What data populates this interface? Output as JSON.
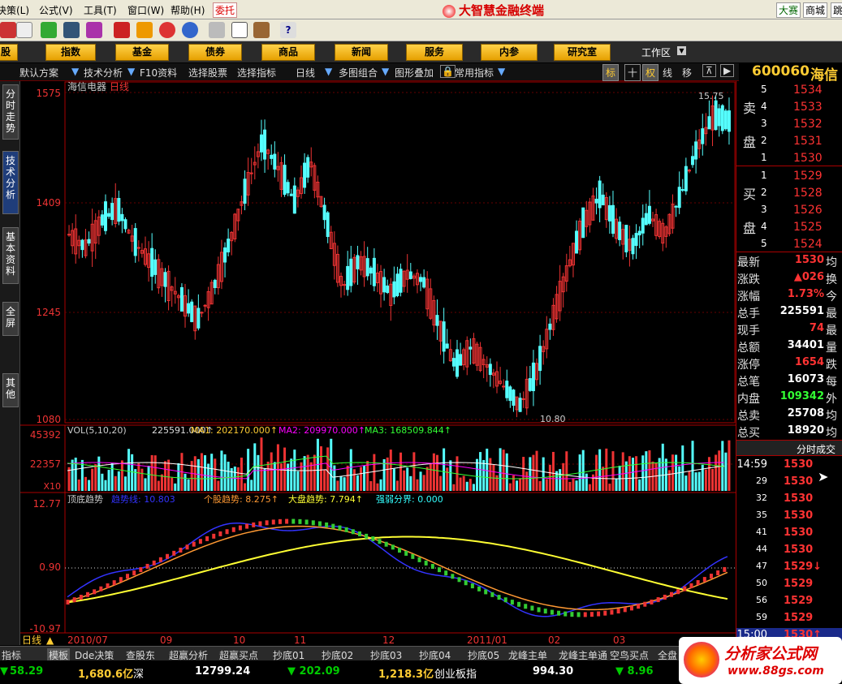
{
  "menu": {
    "items": [
      "决策(L)",
      "公式(V)",
      "工具(T)",
      "窗口(W)",
      "帮助(H)"
    ],
    "entrust": "委托",
    "app_title": "大智慧金融终端",
    "right": [
      "大赛",
      "商城",
      "跳"
    ]
  },
  "toolbar": {
    "icons": [
      "open-icon",
      "order-icon",
      "stocks-icon",
      "chart-icon",
      "alert-icon",
      "news-icon",
      "finance-icon",
      "f10-icon",
      "money-icon",
      "print-icon",
      "window-icon",
      "books-icon",
      "help-icon"
    ]
  },
  "nav": {
    "items": [
      "股",
      "指数",
      "基金",
      "债券",
      "商品",
      "新闻",
      "服务",
      "内参",
      "研究室"
    ],
    "workspace": "工作区"
  },
  "tabs": {
    "items": [
      "默认方案",
      "技术分析",
      "F10资料",
      "选择股票",
      "选择指标",
      "日线",
      "多图组合",
      "图形叠加",
      "常用指标"
    ],
    "tools": [
      "标",
      "十",
      "权",
      "线",
      "移"
    ],
    "stock_code": "600060",
    "stock_name": "海信"
  },
  "side_tabs": [
    "分时走势",
    "技术分析",
    "基本资料",
    "全屏",
    "其他"
  ],
  "main_chart": {
    "title": "海信电器",
    "period": "日线",
    "y_labels": [
      "1575",
      "1409",
      "1245",
      "1080"
    ],
    "high_label": "15.75",
    "low_label": "10.80"
  },
  "vol_chart": {
    "legend_prefix": "VOL(5,10,20)",
    "vol": "225591.000↑",
    "ma1": "MA1: 202170.000↑",
    "ma2": "MA2: 209970.000↑",
    "ma3": "MA3: 168509.844↑",
    "y_labels": [
      "45392",
      "22357",
      "X10"
    ]
  },
  "ind_chart": {
    "name": "顶底趋势",
    "l1": "趋势线: 10.803",
    "l2": "个股趋势: 8.275↑",
    "l3": "大盘趋势: 7.794↑",
    "l4": "强弱分界: 0.000",
    "y_labels": [
      "12.77",
      "0.90",
      "-10.97"
    ]
  },
  "x_axis": {
    "labels": [
      "2010/07",
      "09",
      "10",
      "11",
      "12",
      "2011/01",
      "02",
      "03"
    ],
    "period": "日线"
  },
  "chart_data": {
    "type": "candlestick",
    "price_range": [
      10.8,
      15.75
    ],
    "ohlc_sample": [
      {
        "o": 13.3,
        "c": 13.6,
        "h": 13.9,
        "l": 13.1
      },
      {
        "o": 13.6,
        "c": 13.4,
        "h": 13.8,
        "l": 13.2
      },
      {
        "o": 13.4,
        "c": 13.8,
        "h": 14.0,
        "l": 13.3
      },
      {
        "o": 13.8,
        "c": 14.0,
        "h": 14.2,
        "l": 13.7
      },
      {
        "o": 14.0,
        "c": 13.5,
        "h": 14.1,
        "l": 13.4
      },
      {
        "o": 13.5,
        "c": 13.2,
        "h": 13.6,
        "l": 13.0
      },
      {
        "o": 13.2,
        "c": 12.9,
        "h": 13.3,
        "l": 12.7
      },
      {
        "o": 12.9,
        "c": 12.6,
        "h": 13.0,
        "l": 12.4
      },
      {
        "o": 12.6,
        "c": 12.3,
        "h": 12.7,
        "l": 12.1
      },
      {
        "o": 12.3,
        "c": 12.8,
        "h": 13.0,
        "l": 12.2
      },
      {
        "o": 12.8,
        "c": 13.5,
        "h": 13.7,
        "l": 12.7
      },
      {
        "o": 13.5,
        "c": 14.3,
        "h": 14.5,
        "l": 13.4
      },
      {
        "o": 14.3,
        "c": 15.0,
        "h": 15.2,
        "l": 14.1
      },
      {
        "o": 15.0,
        "c": 14.6,
        "h": 15.1,
        "l": 14.4
      },
      {
        "o": 14.6,
        "c": 14.1,
        "h": 14.8,
        "l": 14.0
      },
      {
        "o": 14.1,
        "c": 14.7,
        "h": 14.9,
        "l": 14.0
      },
      {
        "o": 14.7,
        "c": 13.8,
        "h": 14.8,
        "l": 13.6
      },
      {
        "o": 13.8,
        "c": 12.8,
        "h": 13.9,
        "l": 12.5
      },
      {
        "o": 12.8,
        "c": 13.2,
        "h": 13.4,
        "l": 12.6
      },
      {
        "o": 13.2,
        "c": 13.0,
        "h": 13.3,
        "l": 12.8
      },
      {
        "o": 13.0,
        "c": 12.7,
        "h": 13.1,
        "l": 12.6
      },
      {
        "o": 12.7,
        "c": 13.0,
        "h": 13.1,
        "l": 12.6
      },
      {
        "o": 13.0,
        "c": 12.9,
        "h": 13.2,
        "l": 12.7
      },
      {
        "o": 12.9,
        "c": 12.2,
        "h": 13.0,
        "l": 12.0
      },
      {
        "o": 12.2,
        "c": 11.6,
        "h": 12.3,
        "l": 11.2
      },
      {
        "o": 11.6,
        "c": 11.9,
        "h": 12.2,
        "l": 11.4
      },
      {
        "o": 11.9,
        "c": 11.6,
        "h": 12.0,
        "l": 11.3
      },
      {
        "o": 11.6,
        "c": 11.3,
        "h": 11.7,
        "l": 11.1
      },
      {
        "o": 11.3,
        "c": 11.0,
        "h": 11.4,
        "l": 10.8
      },
      {
        "o": 11.0,
        "c": 11.5,
        "h": 11.6,
        "l": 10.9
      },
      {
        "o": 11.5,
        "c": 12.3,
        "h": 12.5,
        "l": 11.4
      },
      {
        "o": 12.3,
        "c": 13.1,
        "h": 13.3,
        "l": 12.2
      },
      {
        "o": 13.1,
        "c": 13.8,
        "h": 14.0,
        "l": 13.0
      },
      {
        "o": 13.8,
        "c": 14.2,
        "h": 14.4,
        "l": 13.7
      },
      {
        "o": 14.2,
        "c": 13.7,
        "h": 14.3,
        "l": 13.5
      },
      {
        "o": 13.7,
        "c": 13.4,
        "h": 13.8,
        "l": 13.2
      },
      {
        "o": 13.4,
        "c": 13.9,
        "h": 14.1,
        "l": 13.3
      },
      {
        "o": 13.9,
        "c": 13.6,
        "h": 14.0,
        "l": 13.4
      },
      {
        "o": 13.6,
        "c": 14.2,
        "h": 14.4,
        "l": 13.5
      },
      {
        "o": 14.2,
        "c": 14.9,
        "h": 15.1,
        "l": 14.1
      },
      {
        "o": 14.9,
        "c": 15.4,
        "h": 15.75,
        "l": 14.8
      },
      {
        "o": 15.4,
        "c": 15.3,
        "h": 15.6,
        "l": 14.9
      }
    ]
  },
  "quote": {
    "ask_label": [
      "卖",
      "盘"
    ],
    "bid_label": [
      "买",
      "盘"
    ],
    "asks": [
      {
        "lvl": "5",
        "px": "1534"
      },
      {
        "lvl": "4",
        "px": "1533"
      },
      {
        "lvl": "3",
        "px": "1532"
      },
      {
        "lvl": "2",
        "px": "1531"
      },
      {
        "lvl": "1",
        "px": "1530"
      }
    ],
    "bids": [
      {
        "lvl": "1",
        "px": "1529"
      },
      {
        "lvl": "2",
        "px": "1528"
      },
      {
        "lvl": "3",
        "px": "1526"
      },
      {
        "lvl": "4",
        "px": "1525"
      },
      {
        "lvl": "5",
        "px": "1524"
      }
    ],
    "stats": [
      {
        "l": "最新",
        "v": "1530",
        "r": "均"
      },
      {
        "l": "涨跌",
        "v": "▲026",
        "r": "换"
      },
      {
        "l": "涨幅",
        "v": "1.73%",
        "r": "今"
      },
      {
        "l": "总手",
        "v": "225591",
        "r": "最"
      },
      {
        "l": "现手",
        "v": "74",
        "r": "最"
      },
      {
        "l": "总额",
        "v": "34401",
        "r": "量"
      },
      {
        "l": "涨停",
        "v": "1654",
        "r": "跌"
      },
      {
        "l": "总笔",
        "v": "16073",
        "r": "每"
      },
      {
        "l": "内盘",
        "v": "109342",
        "r": "外"
      },
      {
        "l": "总卖",
        "v": "25708",
        "r": "均"
      },
      {
        "l": "总买",
        "v": "18920",
        "r": "均"
      }
    ],
    "trades_title": "分时成交",
    "trades": [
      {
        "t": "14:59",
        "p": "1530"
      },
      {
        "t": "29",
        "p": "1530"
      },
      {
        "t": "32",
        "p": "1530"
      },
      {
        "t": "35",
        "p": "1530"
      },
      {
        "t": "41",
        "p": "1530"
      },
      {
        "t": "44",
        "p": "1530"
      },
      {
        "t": "47",
        "p": "1529↓"
      },
      {
        "t": "50",
        "p": "1529"
      },
      {
        "t": "56",
        "p": "1529"
      },
      {
        "t": "59",
        "p": "1529"
      },
      {
        "t": "15:00",
        "p": "1530↑"
      }
    ]
  },
  "bottom_tabs": [
    "指标",
    "模板",
    "Dde决策",
    "查股东",
    "超赢分析",
    "超赢买点",
    "抄底01",
    "抄底02",
    "抄底03",
    "抄底04",
    "抄底05",
    "龙峰主单",
    "龙峰主单通",
    "空鸟买点",
    "全盘"
  ],
  "status": {
    "items": [
      "58.29",
      "1,680.6亿",
      "深",
      "12799.24",
      "▼ 202.09",
      "1,218.3亿",
      "创业板指",
      "994.30",
      "▼ 8.96"
    ],
    "watermark": "分析家公式网",
    "watermark_url": "www.88gs.com"
  }
}
